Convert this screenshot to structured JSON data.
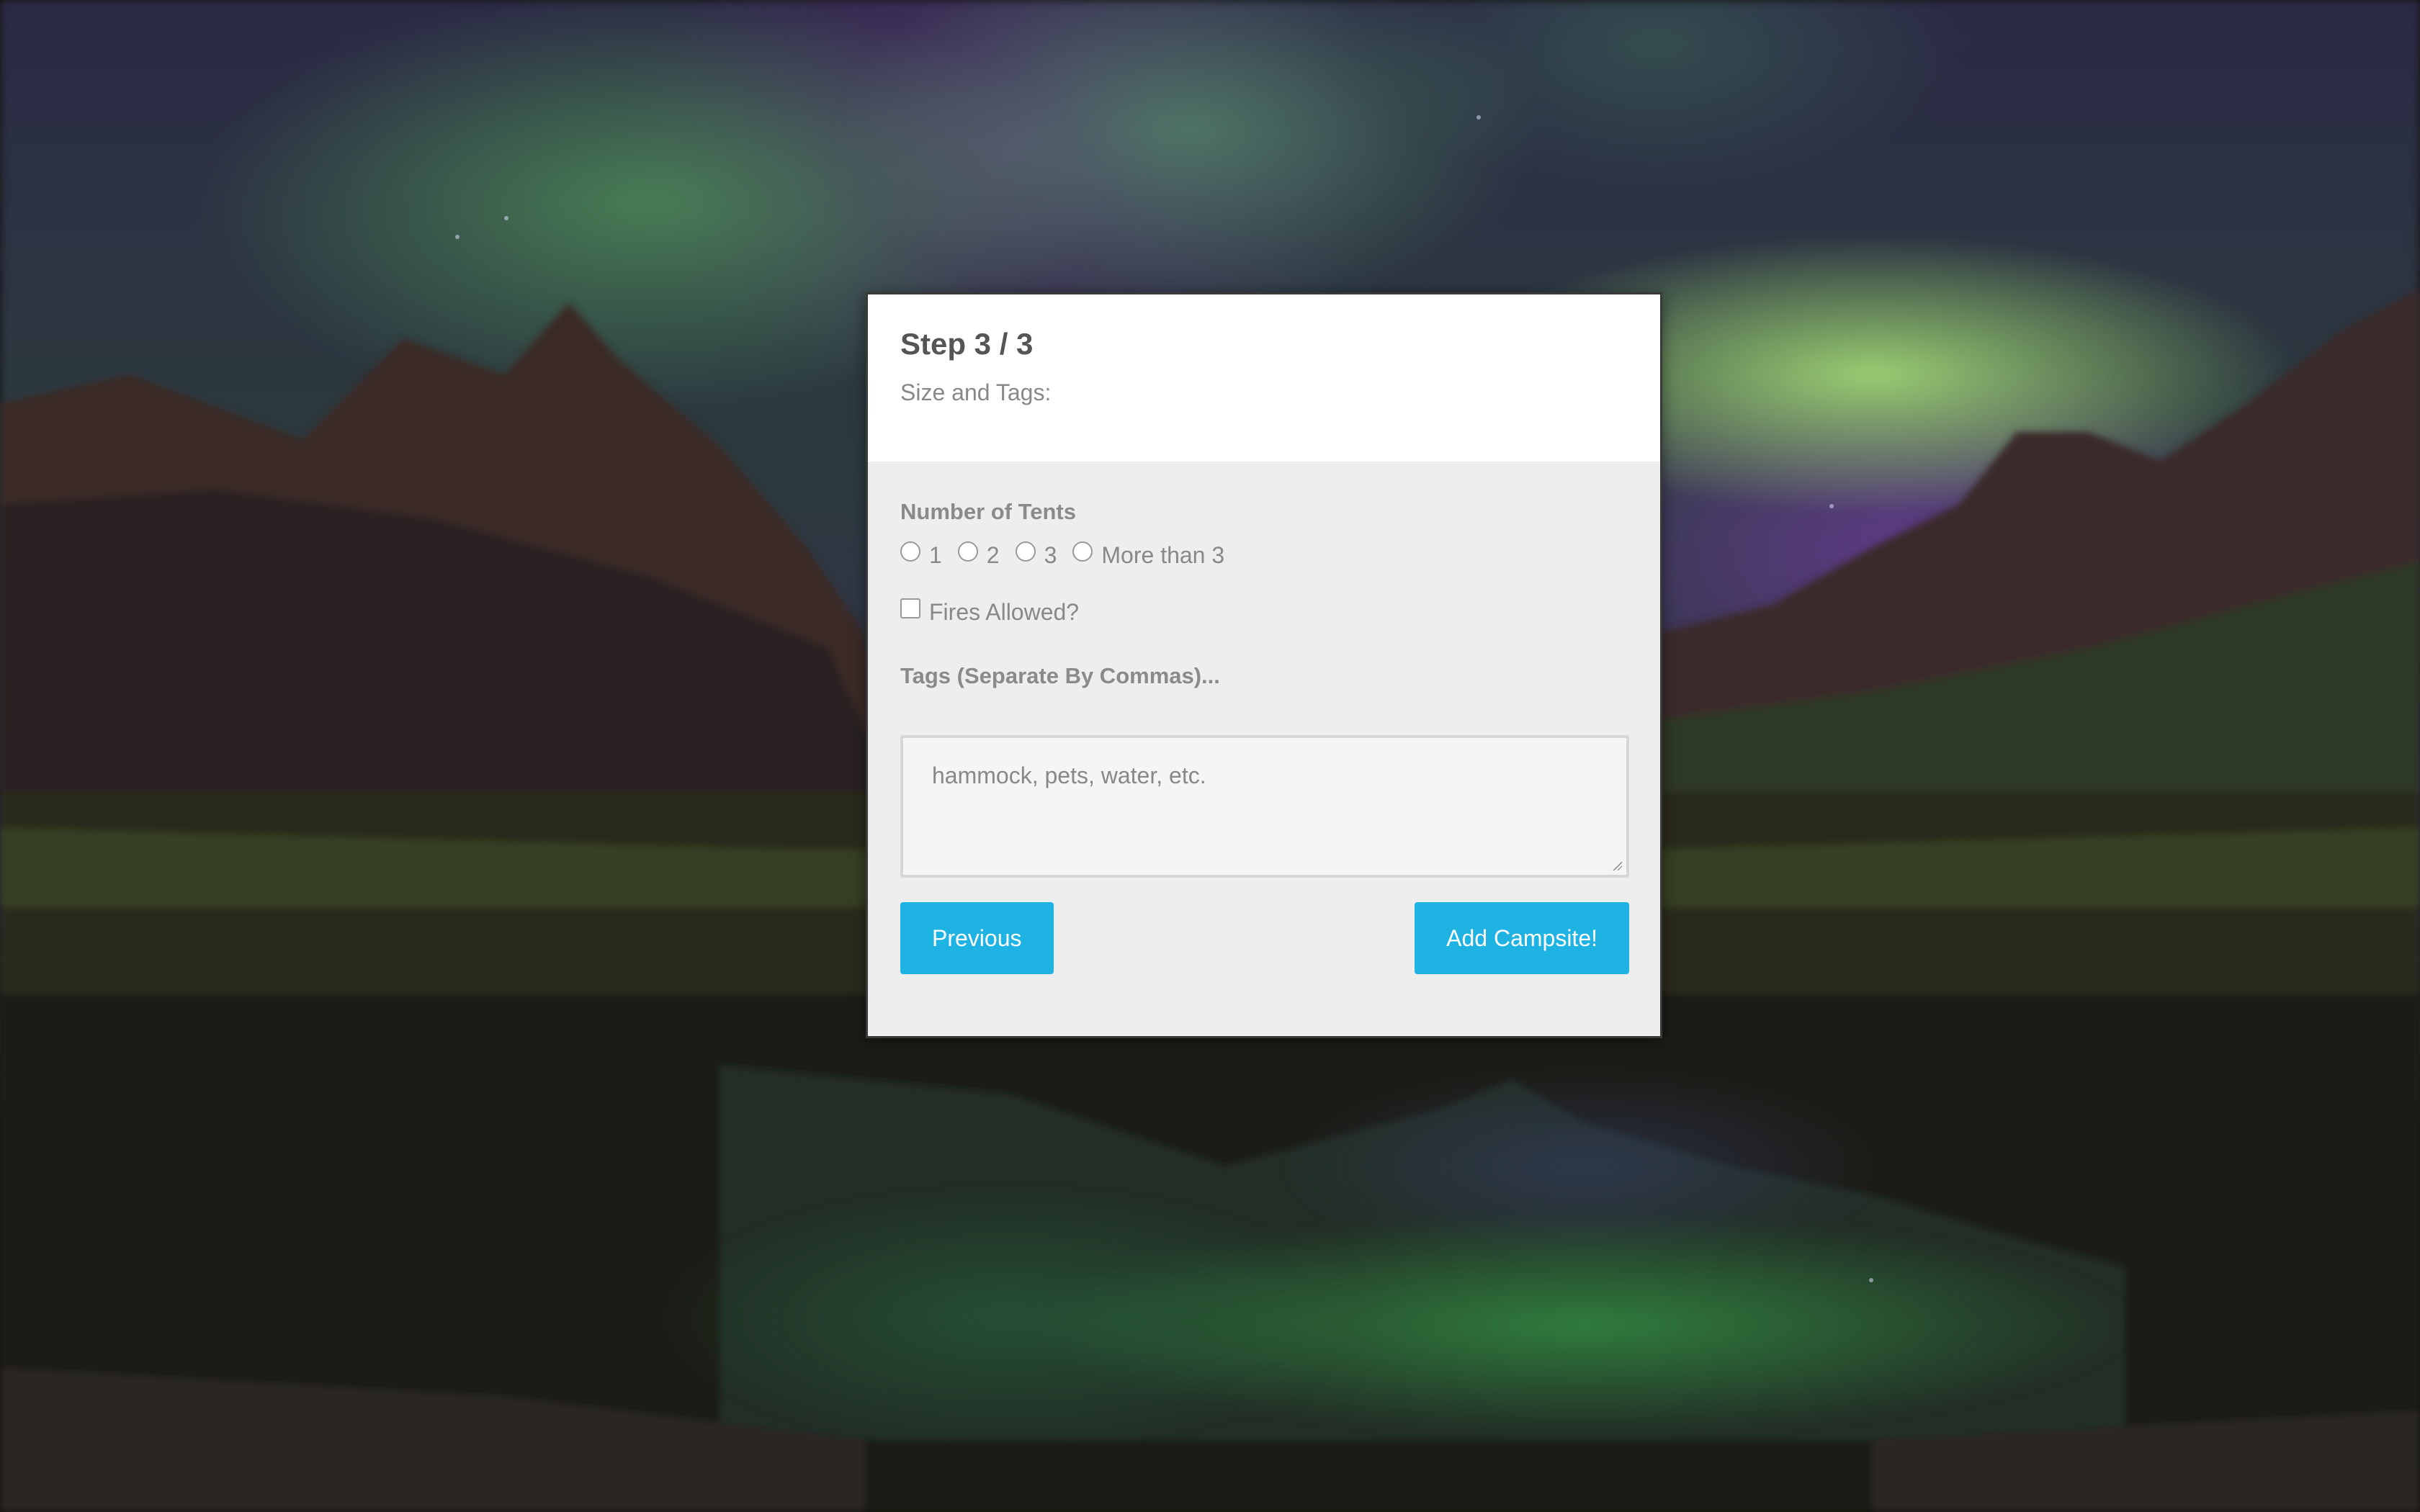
{
  "form": {
    "step_title": "Step 3 / 3",
    "step_subtitle": "Size and Tags:",
    "tents_label": "Number of Tents",
    "tent_options": [
      "1",
      "2",
      "3",
      "More than 3"
    ],
    "fires_label": "Fires Allowed?",
    "tags_label": "Tags (Separate By Commas)...",
    "tags_placeholder": "hammock, pets, water, etc.",
    "previous_label": "Previous",
    "submit_label": "Add Campsite!"
  },
  "colors": {
    "accent": "#1fb3e4",
    "card_body": "#eeeeee",
    "card_header": "#ffffff"
  }
}
